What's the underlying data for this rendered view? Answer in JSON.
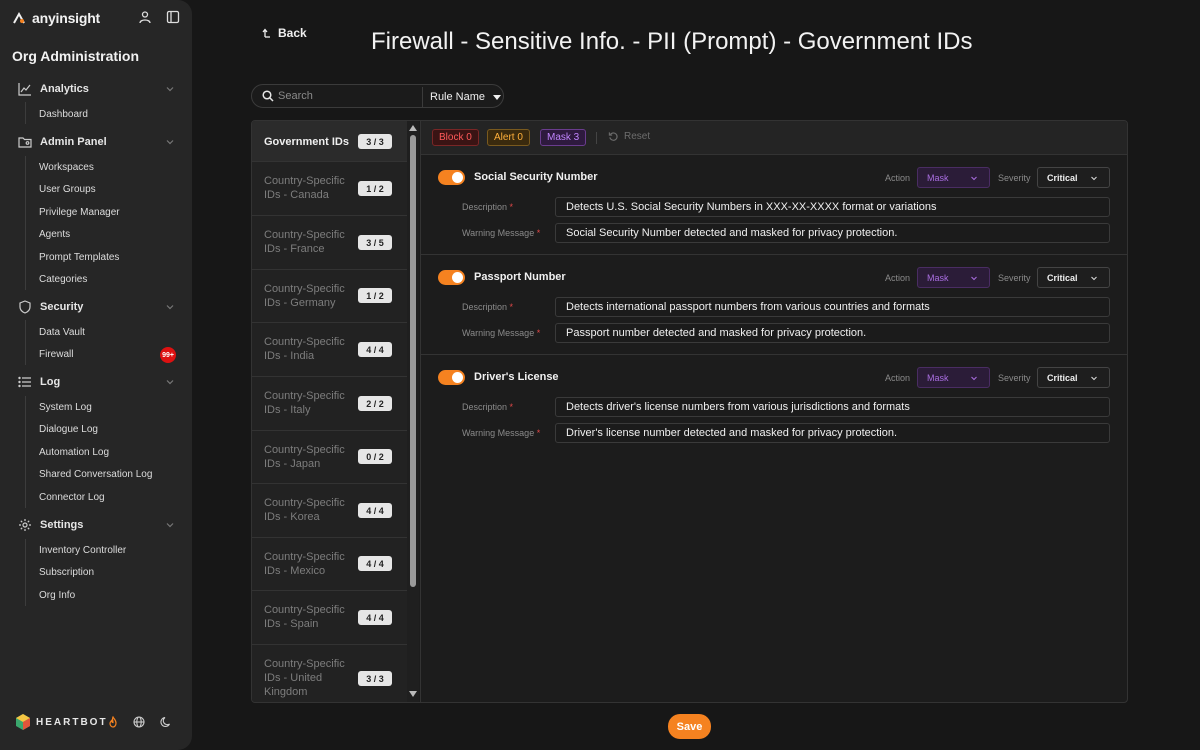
{
  "app": {
    "brand": "anyinsight",
    "org_title": "Org Administration"
  },
  "sidebar": {
    "sections": [
      {
        "label": "Analytics",
        "items": [
          "Dashboard"
        ]
      },
      {
        "label": "Admin Panel",
        "items": [
          "Workspaces",
          "User Groups",
          "Privilege Manager",
          "Agents",
          "Prompt Templates",
          "Categories"
        ]
      },
      {
        "label": "Security",
        "items": [
          "Data Vault",
          "Firewall"
        ]
      },
      {
        "label": "Log",
        "items": [
          "System Log",
          "Dialogue Log",
          "Automation Log",
          "Shared Conversation Log",
          "Connector Log"
        ]
      },
      {
        "label": "Settings",
        "items": [
          "Inventory Controller",
          "Subscription",
          "Org Info"
        ]
      }
    ],
    "firewall_badge": "99+",
    "footer_brand": "HEARTBOT"
  },
  "header": {
    "back_label": "Back",
    "title": "Firewall - Sensitive Info. - PII (Prompt) - Government IDs"
  },
  "search": {
    "placeholder": "Search",
    "filter_label": "Rule Name"
  },
  "categories": [
    {
      "label": "Government IDs",
      "count": "3 / 3"
    },
    {
      "label": "Country-Specific IDs - Canada",
      "count": "1 / 2"
    },
    {
      "label": "Country-Specific IDs - France",
      "count": "3 / 5"
    },
    {
      "label": "Country-Specific IDs - Germany",
      "count": "1 / 2"
    },
    {
      "label": "Country-Specific IDs - India",
      "count": "4 / 4"
    },
    {
      "label": "Country-Specific IDs - Italy",
      "count": "2 / 2"
    },
    {
      "label": "Country-Specific IDs - Japan",
      "count": "0 / 2"
    },
    {
      "label": "Country-Specific IDs - Korea",
      "count": "4 / 4"
    },
    {
      "label": "Country-Specific IDs - Mexico",
      "count": "4 / 4"
    },
    {
      "label": "Country-Specific IDs - Spain",
      "count": "4 / 4"
    },
    {
      "label": "Country-Specific IDs - United Kingdom",
      "count": "3 / 3"
    }
  ],
  "filters": {
    "block": "Block 0",
    "alert": "Alert 0",
    "mask": "Mask 3",
    "reset": "Reset"
  },
  "rule_labels": {
    "action": "Action",
    "severity": "Severity",
    "description": "Description",
    "warning": "Warning Message",
    "required": "*"
  },
  "rules": [
    {
      "name": "Social Security Number",
      "enabled": true,
      "action": "Mask",
      "severity": "Critical",
      "description": "Detects U.S. Social Security Numbers in XXX-XX-XXXX format or variations",
      "warning": "Social Security Number detected and masked for privacy protection."
    },
    {
      "name": "Passport Number",
      "enabled": true,
      "action": "Mask",
      "severity": "Critical",
      "description": "Detects international passport numbers from various countries and formats",
      "warning": "Passport number detected and masked for privacy protection."
    },
    {
      "name": "Driver's License",
      "enabled": true,
      "action": "Mask",
      "severity": "Critical",
      "description": "Detects driver's license numbers from various jurisdictions and formats",
      "warning": "Driver's license number detected and masked for privacy protection."
    }
  ],
  "save_label": "Save",
  "colors": {
    "accent": "#f58220",
    "mask": "#c084fc",
    "block": "#ff5a5a",
    "alert": "#ffb03b",
    "badge": "#dd1111"
  }
}
